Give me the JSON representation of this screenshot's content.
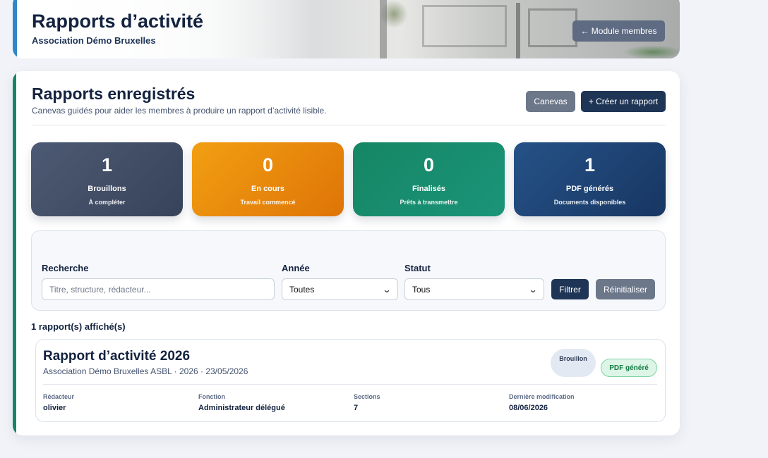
{
  "header": {
    "title": "Rapports d’activité",
    "subtitle": "Association Démo Bruxelles",
    "back_button": "← Module membres"
  },
  "main": {
    "title": "Rapports enregistrés",
    "subtitle": "Canevas guidés pour aider les membres à produire un rapport d’activité lisible.",
    "canevas_button": "Canevas",
    "create_button": "+ Créer un rapport"
  },
  "stats": [
    {
      "value": "1",
      "label": "Brouillons",
      "caption": "À compléter",
      "color": "#3f4b63"
    },
    {
      "value": "0",
      "label": "En cours",
      "caption": "Travail commencé",
      "color": "#e8890c"
    },
    {
      "value": "0",
      "label": "Finalisés",
      "caption": "Prêts à transmettre",
      "color": "#178b6c"
    },
    {
      "value": "1",
      "label": "PDF générés",
      "caption": "Documents disponibles",
      "color": "#1f4576"
    }
  ],
  "filters": {
    "search_label": "Recherche",
    "search_placeholder": "Titre, structure, rédacteur...",
    "year_label": "Année",
    "year_value": "Toutes",
    "status_label": "Statut",
    "status_value": "Tous",
    "filter_button": "Filtrer",
    "reset_button": "Réinitialiser"
  },
  "results": {
    "count_text": "1 rapport(s) affiché(s)"
  },
  "reports": [
    {
      "title": "Rapport d’activité 2026",
      "meta": "Association Démo Bruxelles ASBL · 2026 · 23/05/2026",
      "status_badge": "Brouillon",
      "pdf_badge": "PDF généré",
      "fields": [
        {
          "label": "Rédacteur",
          "value": "olivier"
        },
        {
          "label": "Fonction",
          "value": "Administrateur délégué"
        },
        {
          "label": "Sections",
          "value": "7"
        },
        {
          "label": "Dernière modification",
          "value": "08/06/2026"
        }
      ]
    }
  ],
  "colors": {
    "primary": "#1e3556",
    "secondary": "#6c778a",
    "accent_green": "#168469",
    "accent_blue": "#2f86c9"
  }
}
